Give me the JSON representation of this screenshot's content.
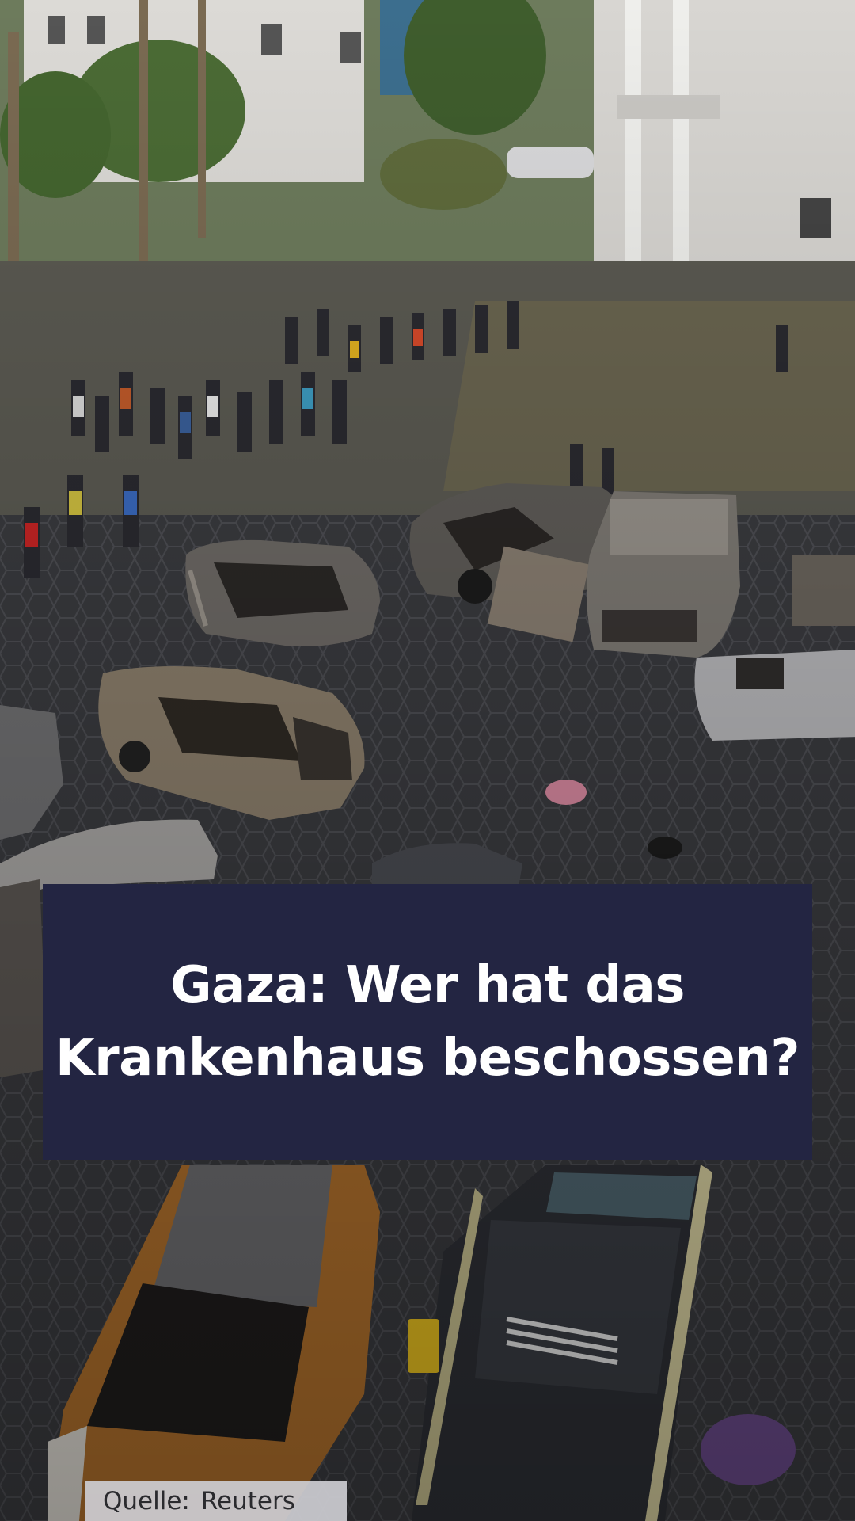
{
  "headline": {
    "line1": "Gaza: Wer hat das",
    "line2": "Krankenhaus beschossen?"
  },
  "source": {
    "label": "Quelle:",
    "name": "Reuters"
  },
  "colors": {
    "headline_background": "#232542",
    "headline_text": "#ffffff",
    "source_background": "#cdcdd2",
    "source_text": "#2a2a2e"
  }
}
